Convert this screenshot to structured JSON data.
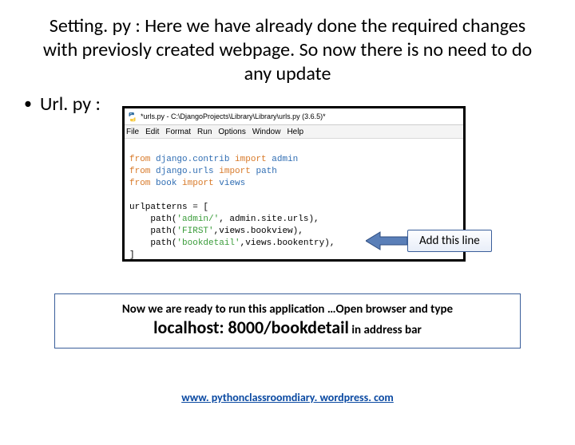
{
  "heading": "Setting. py : Here we have already done the required changes with previosly created webpage. So now there is no need to do any update",
  "bullet": {
    "label": "Url. py :"
  },
  "editor": {
    "title": "*urls.py - C:\\DjangoProjects\\Library\\Library\\urls.py (3.6.5)*",
    "menus": [
      "File",
      "Edit",
      "Format",
      "Run",
      "Options",
      "Window",
      "Help"
    ],
    "code": {
      "l1_kw1": "from",
      "l1_mod": "django.contrib",
      "l1_kw2": "import",
      "l1_cls": "admin",
      "l2_kw1": "from",
      "l2_mod": "django.urls",
      "l2_kw2": "import",
      "l2_cls": "path",
      "l3_kw1": "from",
      "l3_mod": "book",
      "l3_kw2": "import",
      "l3_cls": "views",
      "l4_var": "urlpatterns",
      "l4_eq": " = [",
      "l5_pad": "    ",
      "l5_fn": "path",
      "l5_open": "(",
      "l5_str": "'admin/'",
      "l5_rest": ", admin.site.urls),",
      "l6_pad": "    ",
      "l6_fn": "path",
      "l6_open": "(",
      "l6_str": "'FIRST'",
      "l6_rest": ",views.bookview),",
      "l7_pad": "    ",
      "l7_fn": "path",
      "l7_open": "(",
      "l7_str": "'bookdetail'",
      "l7_rest": ",views.bookentry),",
      "l8_close": "]"
    }
  },
  "callout": {
    "label": "Add this line"
  },
  "ready": {
    "line1": "Now we are ready to run this application …Open browser  and type",
    "url": "localhost: 8000/bookdetail",
    "tail": " in address bar"
  },
  "footer": {
    "text": "www. pythonclassroomdiary. wordpress. com"
  }
}
